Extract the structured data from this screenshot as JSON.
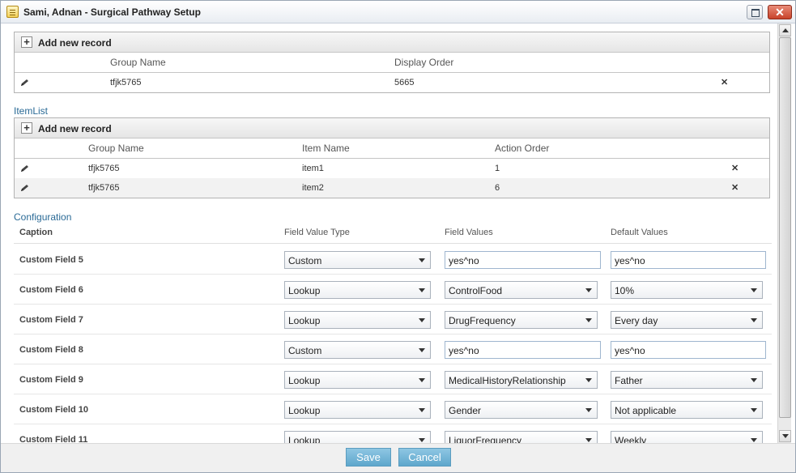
{
  "window": {
    "title": "Sami, Adnan - Surgical Pathway Setup",
    "close_glyph": "✕"
  },
  "group_grid": {
    "add_label": "Add new record",
    "columns": [
      "Group Name",
      "Display Order"
    ],
    "rows": [
      {
        "group_name": "tfjk5765",
        "display_order": "5665"
      }
    ]
  },
  "item_list": {
    "label": "ItemList",
    "add_label": "Add new record",
    "columns": [
      "Group Name",
      "Item Name",
      "Action Order"
    ],
    "rows": [
      {
        "group_name": "tfjk5765",
        "item_name": "item1",
        "action_order": "1"
      },
      {
        "group_name": "tfjk5765",
        "item_name": "item2",
        "action_order": "6"
      }
    ]
  },
  "configuration": {
    "label": "Configuration",
    "columns": [
      "Caption",
      "Field Value Type",
      "Field Values",
      "Default Values"
    ],
    "rows": [
      {
        "caption": "Custom Field 5",
        "type": "Custom",
        "values": "yes^no",
        "default": "yes^no"
      },
      {
        "caption": "Custom Field 6",
        "type": "Lookup",
        "values": "ControlFood",
        "default": "10%"
      },
      {
        "caption": "Custom Field 7",
        "type": "Lookup",
        "values": "DrugFrequency",
        "default": "Every day"
      },
      {
        "caption": "Custom Field 8",
        "type": "Custom",
        "values": "yes^no",
        "default": "yes^no"
      },
      {
        "caption": "Custom Field 9",
        "type": "Lookup",
        "values": "MedicalHistoryRelationship",
        "default": "Father"
      },
      {
        "caption": "Custom Field 10",
        "type": "Lookup",
        "values": "Gender",
        "default": "Not applicable"
      },
      {
        "caption": "Custom Field 11",
        "type": "Lookup",
        "values": "LiquorFrequency",
        "default": "Weekly"
      }
    ]
  },
  "footer": {
    "save_label": "Save",
    "cancel_label": "Cancel"
  },
  "icons": {
    "edit": "pencil-icon",
    "delete": "delete-x-icon",
    "add": "plus-icon"
  },
  "colors": {
    "section_label": "#2a6a96",
    "button": "#6fb2d6"
  }
}
